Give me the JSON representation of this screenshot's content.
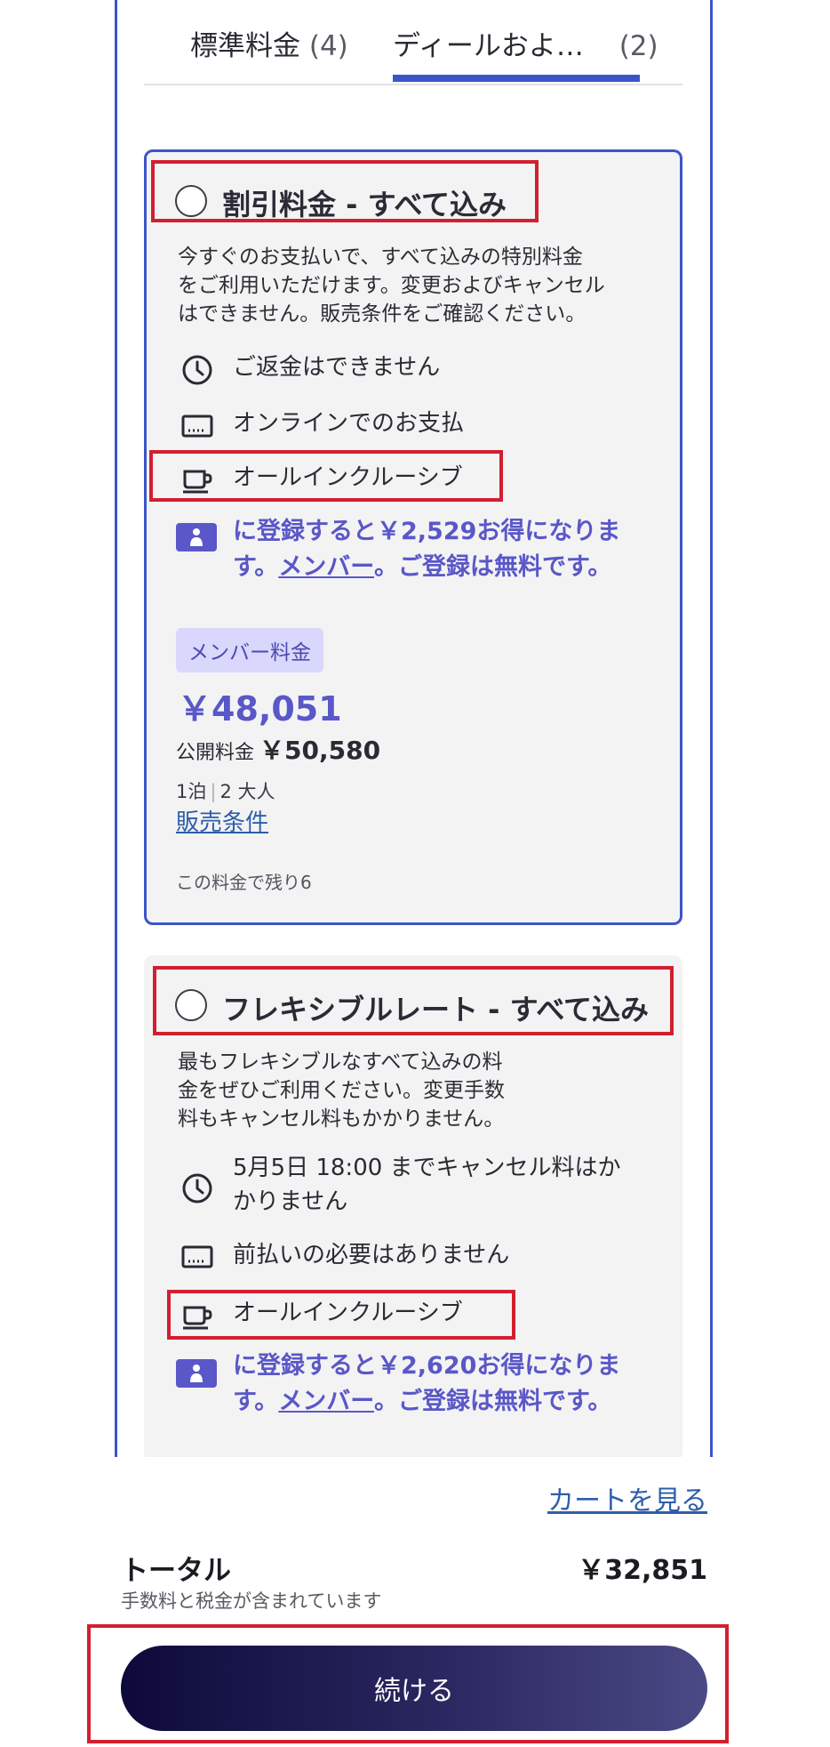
{
  "tabs": [
    {
      "label": "標準料金",
      "count": "(4)"
    },
    {
      "label": "ディールおよ…",
      "count": "(2)"
    }
  ],
  "rates": [
    {
      "title": "割引料金 - すべて込み",
      "description": [
        "今すぐのお支払いで、すべて込みの特別料金",
        "をご利用いただけます。変更およびキャンセル",
        "はできません。販売条件をご確認ください。"
      ],
      "features": [
        "ご返金はできません",
        "オンラインでのお支払",
        "オールインクルーシブ"
      ],
      "promo_line1": "に登録すると￥2,529お得になりま",
      "promo_line2_pre": "す。",
      "promo_link": "メンバー",
      "promo_line2_post": "。ご登録は無料です。",
      "badge": "メンバー料金",
      "price": "￥48,051",
      "public_label": "公開料金",
      "public_price": "￥50,580",
      "nights": "1泊",
      "guests": "2 大人",
      "terms_link": "販売条件",
      "remaining": "この料金で残り6"
    },
    {
      "title": "フレキシブルレート - すべて込み",
      "description": [
        "最もフレキシブルなすべて込みの料",
        "金をぜひご利用ください。変更手数",
        "料もキャンセル料もかかりません。"
      ],
      "features": [
        "5月5日 18:00 までキャンセル料はか",
        "かりません",
        "前払いの必要はありません",
        "オールインクルーシブ"
      ],
      "promo_line1": "に登録すると￥2,620お得になりま",
      "promo_line2_pre": "す。",
      "promo_link": "メンバー",
      "promo_line2_post": "。ご登録は無料です。"
    }
  ],
  "footer": {
    "cart_link": "カートを見る",
    "total_label": "トータル",
    "total_amount": "￥32,851",
    "total_note": "手数料と税金が含まれています",
    "continue_label": "続ける"
  },
  "colors": {
    "accent": "#3b55c9",
    "member": "#5a57c8",
    "highlight": "#d21f2f",
    "link": "#2e5ea8"
  }
}
